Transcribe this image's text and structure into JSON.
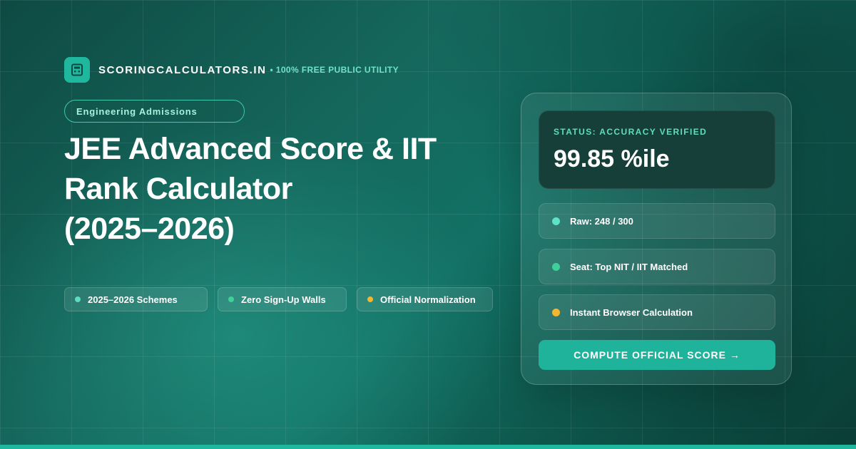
{
  "brand": {
    "name": "SCORINGCALCULATORS.IN",
    "separator": "•",
    "tagline": "100% FREE PUBLIC UTILITY",
    "logo_icon": "calculator-icon"
  },
  "category": "Engineering Admissions",
  "title_lines": [
    "JEE Advanced Score & IIT",
    "Rank Calculator",
    "(2025–2026)"
  ],
  "chips": [
    {
      "label": "2025–2026 Schemes",
      "dot_color": "#5fdcc0"
    },
    {
      "label": "Zero Sign-Up Walls",
      "dot_color": "#3fd09a"
    },
    {
      "label": "Official Normalization",
      "dot_color": "#f2b632"
    }
  ],
  "card": {
    "status_label": "STATUS: ACCURACY VERIFIED",
    "status_value": "99.85 %ile",
    "rows": [
      {
        "label": "Raw: 248 / 300",
        "dot_color": "#5fe3c8"
      },
      {
        "label": "Seat: Top NIT / IIT Matched",
        "dot_color": "#3fd09a"
      },
      {
        "label": "Instant Browser Calculation",
        "dot_color": "#f2b632"
      }
    ],
    "cta_label": "COMPUTE OFFICIAL SCORE →"
  },
  "colors": {
    "accent": "#1fb89e",
    "accent_text": "#6fe3c8",
    "status_panel": "#173f3a",
    "background_dark": "#0e4a43",
    "background_mid": "#15675c"
  }
}
